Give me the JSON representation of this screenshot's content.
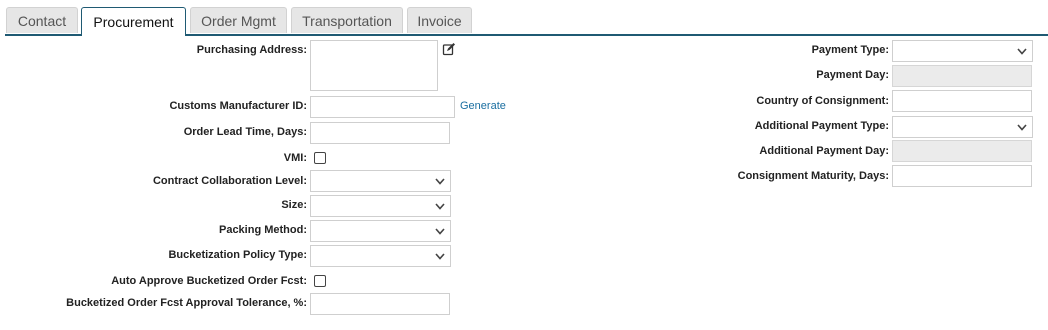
{
  "tabs": [
    {
      "label": "Contact"
    },
    {
      "label": "Procurement"
    },
    {
      "label": "Order Mgmt"
    },
    {
      "label": "Transportation"
    },
    {
      "label": "Invoice"
    }
  ],
  "active_tab": "Procurement",
  "left_form": {
    "purchasing_address": {
      "label": "Purchasing Address:",
      "value": ""
    },
    "customs_manufacturer_id": {
      "label": "Customs Manufacturer ID:",
      "value": "",
      "action": "Generate"
    },
    "order_lead_time": {
      "label": "Order Lead Time, Days:",
      "value": ""
    },
    "vmi": {
      "label": "VMI:",
      "checked": false
    },
    "contract_collaboration_level": {
      "label": "Contract Collaboration Level:",
      "value": ""
    },
    "size": {
      "label": "Size:",
      "value": ""
    },
    "packing_method": {
      "label": "Packing Method:",
      "value": ""
    },
    "bucketization_policy_type": {
      "label": "Bucketization Policy Type:",
      "value": ""
    },
    "auto_approve_bucketized": {
      "label": "Auto Approve Bucketized Order Fcst:",
      "checked": false
    },
    "approval_tolerance": {
      "label": "Bucketized Order Fcst Approval Tolerance, %:",
      "value": ""
    }
  },
  "right_form": {
    "payment_type": {
      "label": "Payment Type:",
      "value": ""
    },
    "payment_day": {
      "label": "Payment Day:",
      "value": ""
    },
    "country_of_consignment": {
      "label": "Country of Consignment:",
      "value": ""
    },
    "additional_payment_type": {
      "label": "Additional Payment Type:",
      "value": ""
    },
    "additional_payment_day": {
      "label": "Additional Payment Day:",
      "value": ""
    },
    "consignment_maturity": {
      "label": "Consignment Maturity, Days:",
      "value": ""
    }
  },
  "icons": {
    "edit": "edit-icon",
    "dropdown": "chevron-down-icon"
  },
  "colors": {
    "accent": "#1f5a73",
    "link": "#1a6ea0",
    "readonly_bg": "#ebebeb"
  }
}
